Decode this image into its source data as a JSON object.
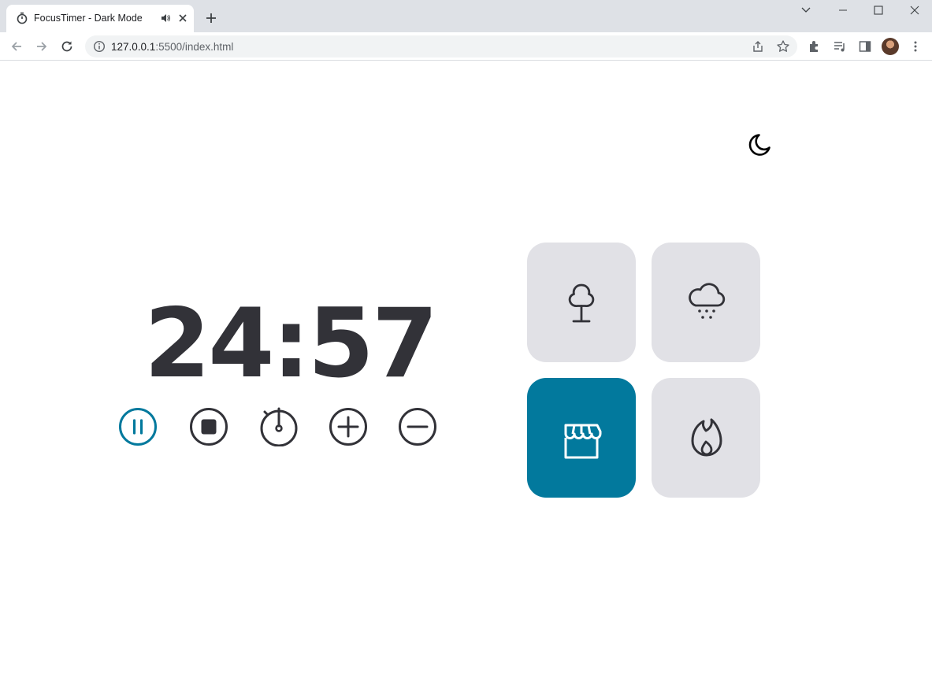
{
  "browser": {
    "tab_title": "FocusTimer - Dark Mode",
    "url_host": "127.0.0.1",
    "url_rest": ":5500/index.html"
  },
  "timer": {
    "minutes": "24",
    "separator": ":",
    "seconds": "57",
    "display": "24:57"
  },
  "controls": [
    {
      "name": "pause",
      "icon": "pause-icon",
      "active": true
    },
    {
      "name": "stop",
      "icon": "stop-icon",
      "active": false
    },
    {
      "name": "set-timer",
      "icon": "stopwatch-icon",
      "active": false
    },
    {
      "name": "increase",
      "icon": "plus-icon",
      "active": false
    },
    {
      "name": "decrease",
      "icon": "minus-icon",
      "active": false
    }
  ],
  "sounds": [
    {
      "name": "forest",
      "icon": "tree-icon",
      "active": false
    },
    {
      "name": "rain",
      "icon": "rain-cloud-icon",
      "active": false
    },
    {
      "name": "coffee-shop",
      "icon": "storefront-icon",
      "active": true
    },
    {
      "name": "fireplace",
      "icon": "flame-icon",
      "active": false
    }
  ],
  "colors": {
    "accent": "#02799d",
    "text": "#323238",
    "card": "#e1e1e6",
    "background": "#ffffff"
  }
}
